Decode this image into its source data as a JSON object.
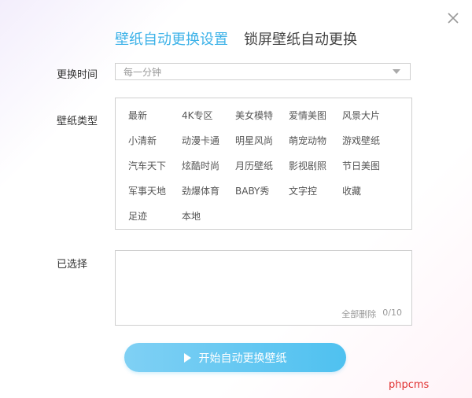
{
  "tabs": [
    {
      "label": "壁纸自动更换设置",
      "active": true
    },
    {
      "label": "锁屏壁纸自动更换",
      "active": false
    }
  ],
  "interval": {
    "label": "更换时间",
    "value": "每一分钟"
  },
  "types": {
    "label": "壁纸类型",
    "items": [
      "最新",
      "4K专区",
      "美女模特",
      "爱情美图",
      "风景大片",
      "小清新",
      "动漫卡通",
      "明星风尚",
      "萌宠动物",
      "游戏壁纸",
      "汽车天下",
      "炫酷时尚",
      "月历壁纸",
      "影视剧照",
      "节日美图",
      "军事天地",
      "劲爆体育",
      "BABY秀",
      "文字控",
      "收藏",
      "足迹",
      "本地"
    ]
  },
  "selected": {
    "label": "已选择",
    "delete_all": "全部删除",
    "count": "0/10"
  },
  "start_button": {
    "label": "开始自动更换壁纸"
  },
  "watermark": "phpcms",
  "colors": {
    "accent": "#3db2e8",
    "button": "#4fc1f0",
    "watermark": "#e03030"
  }
}
